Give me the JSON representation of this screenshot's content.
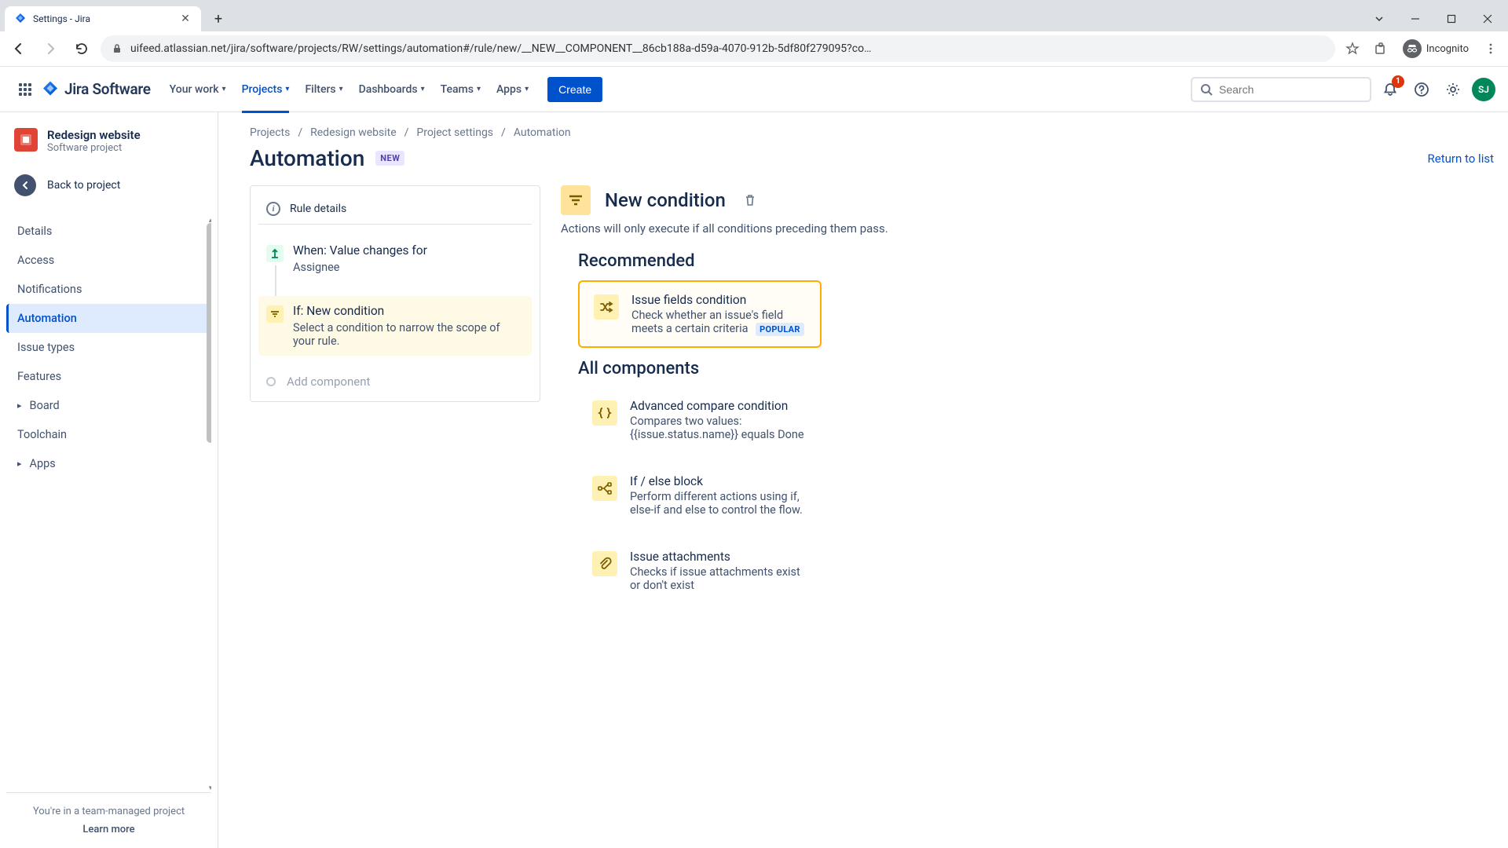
{
  "browser": {
    "tab_title": "Settings - Jira",
    "url": "uifeed.atlassian.net/jira/software/projects/RW/settings/automation#/rule/new/__NEW__COMPONENT__86cb188a-d59a-4070-912b-5df80f279095?co…",
    "incognito_label": "Incognito"
  },
  "nav": {
    "product": "Jira Software",
    "items": [
      {
        "label": "Your work"
      },
      {
        "label": "Projects",
        "active": true
      },
      {
        "label": "Filters"
      },
      {
        "label": "Dashboards"
      },
      {
        "label": "Teams"
      },
      {
        "label": "Apps"
      }
    ],
    "create_label": "Create",
    "search_placeholder": "Search",
    "notif_count": "1",
    "avatar_initials": "SJ"
  },
  "sidebar": {
    "project_name": "Redesign website",
    "project_type": "Software project",
    "back_label": "Back to project",
    "items": [
      {
        "label": "Details"
      },
      {
        "label": "Access"
      },
      {
        "label": "Notifications"
      },
      {
        "label": "Automation",
        "active": true
      },
      {
        "label": "Issue types"
      },
      {
        "label": "Features"
      },
      {
        "label": "Board",
        "expandable": true
      },
      {
        "label": "Toolchain"
      },
      {
        "label": "Apps",
        "expandable": true
      }
    ],
    "footer": "You're in a team-managed project",
    "footer_link": "Learn more"
  },
  "breadcrumbs": [
    "Projects",
    "Redesign website",
    "Project settings",
    "Automation"
  ],
  "page": {
    "title": "Automation",
    "badge": "NEW",
    "return": "Return to list"
  },
  "rule": {
    "details_label": "Rule details",
    "step1_title": "When: Value changes for",
    "step1_sub": "Assignee",
    "step2_title": "If: New condition",
    "step2_sub": "Select a condition to narrow the scope of your rule.",
    "add_label": "Add component"
  },
  "picker": {
    "title": "New condition",
    "description": "Actions will only execute if all conditions preceding them pass.",
    "section_recommended": "Recommended",
    "section_all": "All components",
    "popular_badge": "POPULAR",
    "recommended": {
      "title": "Issue fields condition",
      "desc": "Check whether an issue's field meets a certain criteria"
    },
    "components": [
      {
        "title": "Advanced compare condition",
        "desc": "Compares two values: {{issue.status.name}} equals Done"
      },
      {
        "title": "If / else block",
        "desc": "Perform different actions using if, else-if and else to control the flow."
      },
      {
        "title": "Issue attachments",
        "desc": "Checks if issue attachments exist or don't exist"
      }
    ]
  }
}
